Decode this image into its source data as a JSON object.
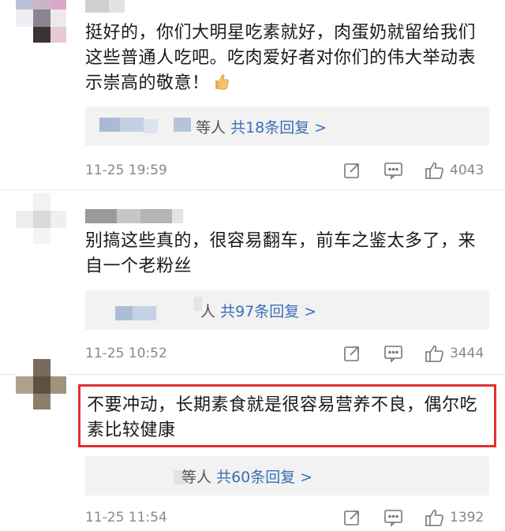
{
  "comments": [
    {
      "text": "挺好的，你们大明星吃素就好，肉蛋奶就留给我们这些普通人吃吧。吃肉爱好者对你们的伟大举动表示崇高的敬意！",
      "reply_prefix": "等人",
      "reply_count": "共18条回复 >",
      "date": "11-25 19:59",
      "likes": "4043",
      "emoji": "thumbs-up-icon"
    },
    {
      "text": "别搞这些真的，很容易翻车，前车之鉴太多了，来自一个老粉丝",
      "reply_prefix": "人",
      "reply_count": "共97条回复 >",
      "date": "11-25 10:52",
      "likes": "3444"
    },
    {
      "text": "不要冲动，长期素食就是很容易营养不良，偶尔吃素比较健康",
      "reply_prefix": "等人",
      "reply_count": "共60条回复 >",
      "date": "11-25 11:54",
      "likes": "1392",
      "highlight_color": "#e23030"
    }
  ],
  "icons": [
    "share-icon",
    "comment-icon",
    "like-icon"
  ],
  "colors": {
    "link": "#3b6fb6",
    "meta": "#888888",
    "highlight": "#e23030"
  }
}
